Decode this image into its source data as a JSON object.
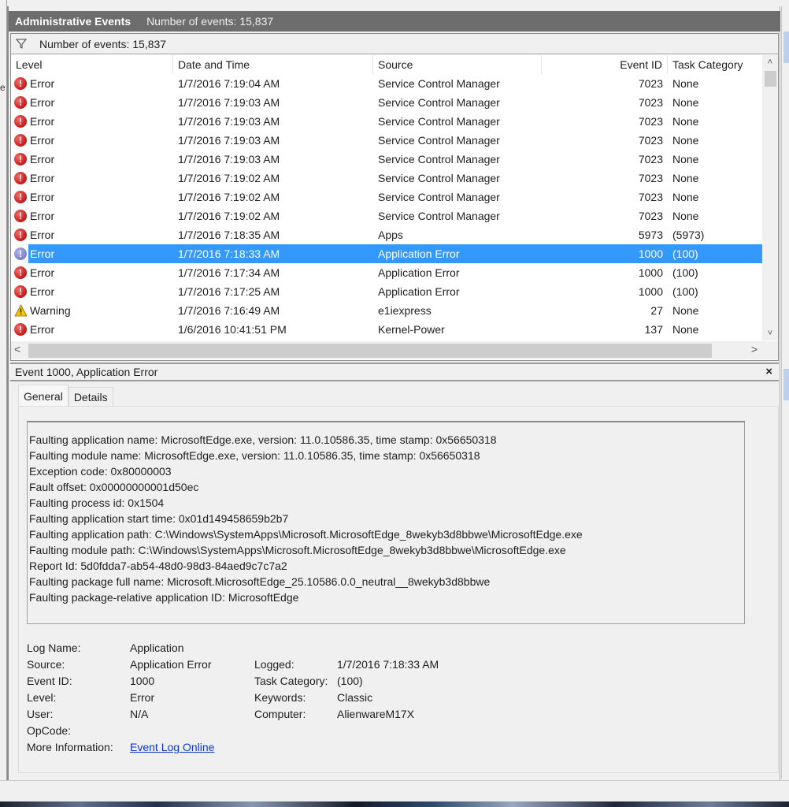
{
  "left_fragment": "e",
  "header": {
    "title": "Administrative Events",
    "count_text": "Number of events: 15,837"
  },
  "filter_bar": {
    "icon": "filter-icon",
    "text": "Number of events: 15,837"
  },
  "grid": {
    "columns": [
      "Level",
      "Date and Time",
      "Source",
      "Event ID",
      "Task Category"
    ],
    "rows": [
      {
        "level": "Error",
        "date": "1/7/2016 7:19:04 AM",
        "source": "Service Control Manager",
        "id": "7023",
        "task": "None"
      },
      {
        "level": "Error",
        "date": "1/7/2016 7:19:03 AM",
        "source": "Service Control Manager",
        "id": "7023",
        "task": "None"
      },
      {
        "level": "Error",
        "date": "1/7/2016 7:19:03 AM",
        "source": "Service Control Manager",
        "id": "7023",
        "task": "None"
      },
      {
        "level": "Error",
        "date": "1/7/2016 7:19:03 AM",
        "source": "Service Control Manager",
        "id": "7023",
        "task": "None"
      },
      {
        "level": "Error",
        "date": "1/7/2016 7:19:03 AM",
        "source": "Service Control Manager",
        "id": "7023",
        "task": "None"
      },
      {
        "level": "Error",
        "date": "1/7/2016 7:19:02 AM",
        "source": "Service Control Manager",
        "id": "7023",
        "task": "None"
      },
      {
        "level": "Error",
        "date": "1/7/2016 7:19:02 AM",
        "source": "Service Control Manager",
        "id": "7023",
        "task": "None"
      },
      {
        "level": "Error",
        "date": "1/7/2016 7:19:02 AM",
        "source": "Service Control Manager",
        "id": "7023",
        "task": "None"
      },
      {
        "level": "Error",
        "date": "1/7/2016 7:18:35 AM",
        "source": "Apps",
        "id": "5973",
        "task": "(5973)"
      },
      {
        "level": "Error",
        "date": "1/7/2016 7:18:33 AM",
        "source": "Application Error",
        "id": "1000",
        "task": "(100)",
        "selected": true
      },
      {
        "level": "Error",
        "date": "1/7/2016 7:17:34 AM",
        "source": "Application Error",
        "id": "1000",
        "task": "(100)"
      },
      {
        "level": "Error",
        "date": "1/7/2016 7:17:25 AM",
        "source": "Application Error",
        "id": "1000",
        "task": "(100)"
      },
      {
        "level": "Warning",
        "date": "1/7/2016 7:16:49 AM",
        "source": "e1iexpress",
        "id": "27",
        "task": "None"
      },
      {
        "level": "Error",
        "date": "1/6/2016 10:41:51 PM",
        "source": "Kernel-Power",
        "id": "137",
        "task": "None"
      }
    ]
  },
  "scroll": {
    "up": "^",
    "down": "v",
    "left": "<",
    "right": ">"
  },
  "detail": {
    "title": "Event 1000, Application Error",
    "close": "×",
    "tabs": [
      "General",
      "Details"
    ],
    "description": [
      "Faulting application name: MicrosoftEdge.exe, version: 11.0.10586.35, time stamp: 0x56650318",
      "Faulting module name: MicrosoftEdge.exe, version: 11.0.10586.35, time stamp: 0x56650318",
      "Exception code: 0x80000003",
      "Fault offset: 0x00000000001d50ec",
      "Faulting process id: 0x1504",
      "Faulting application start time: 0x01d149458659b2b7",
      "Faulting application path: C:\\Windows\\SystemApps\\Microsoft.MicrosoftEdge_8wekyb3d8bbwe\\MicrosoftEdge.exe",
      "Faulting module path: C:\\Windows\\SystemApps\\Microsoft.MicrosoftEdge_8wekyb3d8bbwe\\MicrosoftEdge.exe",
      "Report Id: 5d0fdda7-ab54-48d0-98d3-84aed9c7c7a2",
      "Faulting package full name: Microsoft.MicrosoftEdge_25.10586.0.0_neutral__8wekyb3d8bbwe",
      "Faulting package-relative application ID: MicrosoftEdge"
    ],
    "props": {
      "log_name_label": "Log Name:",
      "log_name": "Application",
      "source_label": "Source:",
      "source": "Application Error",
      "logged_label": "Logged:",
      "logged": "1/7/2016 7:18:33 AM",
      "event_id_label": "Event ID:",
      "event_id": "1000",
      "task_label": "Task Category:",
      "task": "(100)",
      "level_label": "Level:",
      "level": "Error",
      "keywords_label": "Keywords:",
      "keywords": "Classic",
      "user_label": "User:",
      "user": "N/A",
      "computer_label": "Computer:",
      "computer": "AlienwareM17X",
      "opcode_label": "OpCode:",
      "opcode": "",
      "more_info_label": "More Information:",
      "more_info_link": "Event Log Online"
    }
  },
  "colors": {
    "selection": "#3399ff",
    "title_bar": "#6d6d6d",
    "error_icon": "#c41818",
    "warning_icon": "#f5c400",
    "link": "#0b36d0"
  }
}
